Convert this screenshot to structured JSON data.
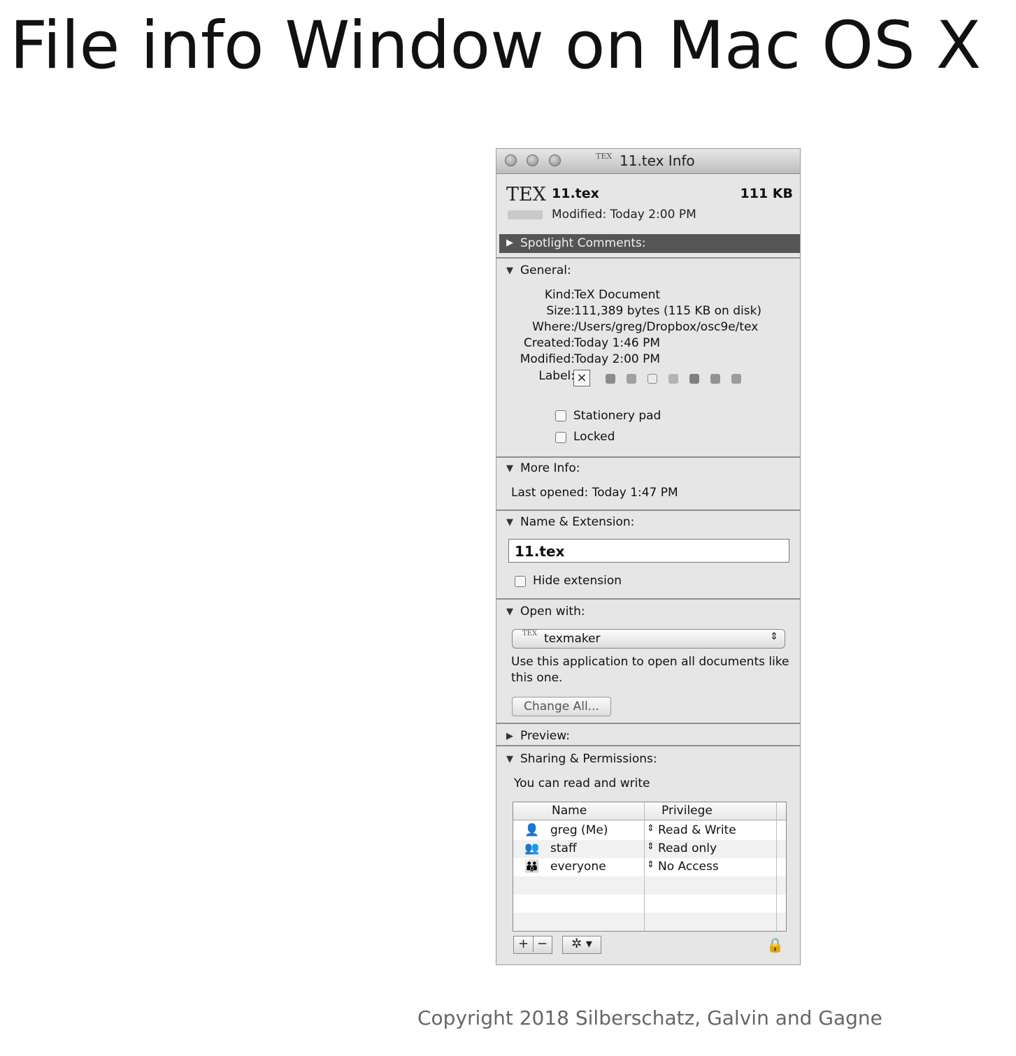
{
  "slide": {
    "title": "File info Window on Mac OS X",
    "copyright": "Copyright 2018 Silberschatz, Galvin and Gagne"
  },
  "window": {
    "title": "11.tex Info",
    "title_icon": "TEX"
  },
  "file": {
    "icon_text": "TEX",
    "name": "11.tex",
    "size": "111 KB",
    "modified": "Modified: Today 2:00 PM"
  },
  "sections": {
    "spotlight": "Spotlight Comments:",
    "general": "General:",
    "more_info": "More Info:",
    "name_ext": "Name & Extension:",
    "open_with": "Open with:",
    "preview": "Preview:",
    "sharing": "Sharing & Permissions:"
  },
  "general": {
    "kind_key": "Kind:",
    "kind": "TeX Document",
    "size_key": "Size:",
    "size": "111,389 bytes (115 KB on disk)",
    "where_key": "Where:",
    "where": "/Users/greg/Dropbox/osc9e/tex",
    "created_key": "Created:",
    "created": "Today 1:46 PM",
    "modified_key": "Modified:",
    "modified": "Today 2:00 PM",
    "label_key": "Label:",
    "label_none": "×",
    "stationery": "Stationery pad",
    "locked": "Locked"
  },
  "more_info": {
    "last_opened": "Last opened: Today 1:47 PM"
  },
  "name_ext": {
    "value": "11.tex",
    "hide_extension": "Hide extension"
  },
  "open_with": {
    "app_icon": "TEX",
    "app": "texmaker",
    "arrows": "⇕",
    "help": "Use this application to open all documents like this one.",
    "change_all": "Change All..."
  },
  "sharing": {
    "status": "You can read and write",
    "col_name": "Name",
    "col_privilege": "Privilege",
    "rows": [
      {
        "name": "greg (Me)",
        "privilege": "Read & Write"
      },
      {
        "name": "staff",
        "privilege": "Read only"
      },
      {
        "name": "everyone",
        "privilege": "No Access"
      }
    ],
    "add": "+",
    "remove": "−",
    "action": "✲ ▾"
  },
  "colors": {
    "window_bg": "#e6e6e6",
    "spotlight_bar": "#555555"
  },
  "icons": [
    "close-button-icon",
    "minimize-button-icon",
    "zoom-button-icon",
    "tex-file-icon",
    "disclosure-triangle-icon",
    "user-icon",
    "group-icon",
    "everyone-icon",
    "gear-icon",
    "lock-icon"
  ]
}
